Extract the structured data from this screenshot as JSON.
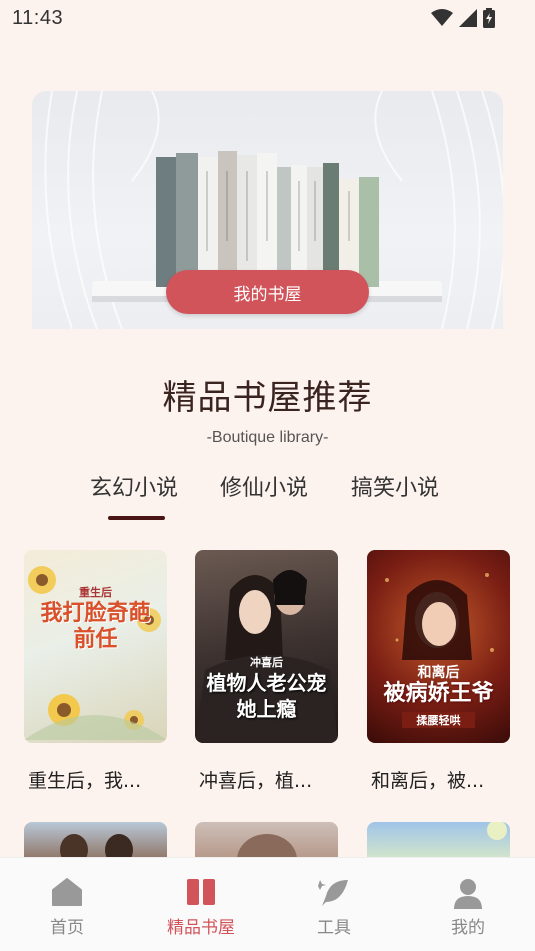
{
  "status": {
    "time": "11:43"
  },
  "banner": {
    "button_label": "我的书屋"
  },
  "section": {
    "title": "精品书屋推荐",
    "subtitle": "-Boutique library-"
  },
  "tabs": [
    {
      "label": "玄幻小说",
      "active": true
    },
    {
      "label": "修仙小说",
      "active": false
    },
    {
      "label": "搞笑小说",
      "active": false
    }
  ],
  "books": [
    {
      "title": "重生后，我...",
      "cover_small": "重生后",
      "cover_main": "我打脸奇葩前任"
    },
    {
      "title": "冲喜后，植...",
      "cover_small": "冲喜后",
      "cover_main": "植物人老公宠她上瘾"
    },
    {
      "title": "和离后，被...",
      "cover_small": "和离后",
      "cover_main": "被病娇王爷",
      "cover_sub": "揉腰轻哄"
    }
  ],
  "nav": [
    {
      "label": "首页",
      "icon": "home-icon",
      "active": false
    },
    {
      "label": "精品书屋",
      "icon": "book-icon",
      "active": true
    },
    {
      "label": "工具",
      "icon": "feather-icon",
      "active": false
    },
    {
      "label": "我的",
      "icon": "user-icon",
      "active": false
    }
  ],
  "colors": {
    "accent": "#d1545a",
    "background": "#fdf3ee",
    "indicator": "#4a1414"
  }
}
